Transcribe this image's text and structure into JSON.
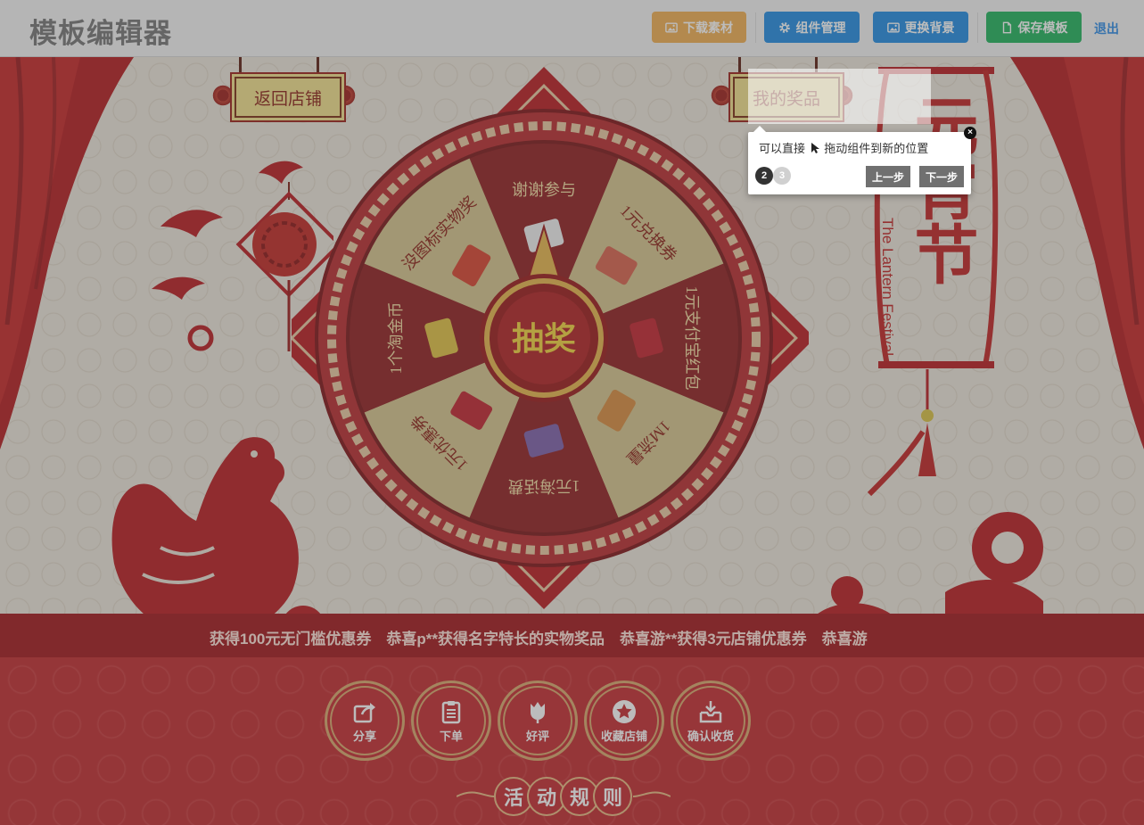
{
  "toolbar": {
    "title": "模板编辑器",
    "download_label": "下载素材",
    "components_label": "组件管理",
    "background_label": "更换背景",
    "save_label": "保存模板",
    "exit_label": "退出"
  },
  "stage": {
    "back_to_shop": "返回店铺",
    "my_prizes": "我的奖品",
    "festival_title": "元宵节",
    "festival_subtitle": "The Lantern Festival"
  },
  "wheel": {
    "center_label": "抽奖",
    "prizes": [
      {
        "label": "谢谢参与",
        "icon": "panda-face-icon"
      },
      {
        "label": "1元兑换券",
        "icon": "coupon-icon"
      },
      {
        "label": "1元支付宝红包",
        "icon": "red-envelope-icon"
      },
      {
        "label": "1M流量",
        "icon": "data-card-icon"
      },
      {
        "label": "1元海话费",
        "icon": "phone-credit-icon"
      },
      {
        "label": "1元优惠券",
        "icon": "discount-ticket-icon"
      },
      {
        "label": "1个淘金币",
        "icon": "gold-coin-icon"
      },
      {
        "label": "没图标实物奖",
        "icon": "gift-box-icon"
      }
    ],
    "colors": {
      "dark": "#8f1a1c",
      "light": "#d6c38b",
      "ring": "#b8282a",
      "pointer": "#e7b54a"
    }
  },
  "marquee": {
    "text": "获得100元无门槛优惠券　恭喜p**获得名字特长的实物奖品　恭喜游**获得3元店铺优惠券　恭喜游"
  },
  "actions": [
    {
      "label": "分享",
      "icon": "share-icon"
    },
    {
      "label": "下单",
      "icon": "clipboard-icon"
    },
    {
      "label": "好评",
      "icon": "tulip-icon"
    },
    {
      "label": "收藏店铺",
      "icon": "star-icon"
    },
    {
      "label": "确认收货",
      "icon": "inbox-download-icon"
    }
  ],
  "rules": {
    "chars": [
      "活",
      "动",
      "规",
      "则"
    ]
  },
  "tour": {
    "text_before": "可以直接",
    "text_after": "拖动组件到新的位置",
    "current_step": "2",
    "next_step": "3",
    "prev_label": "上一步",
    "next_label": "下一步",
    "close_label": "×"
  }
}
